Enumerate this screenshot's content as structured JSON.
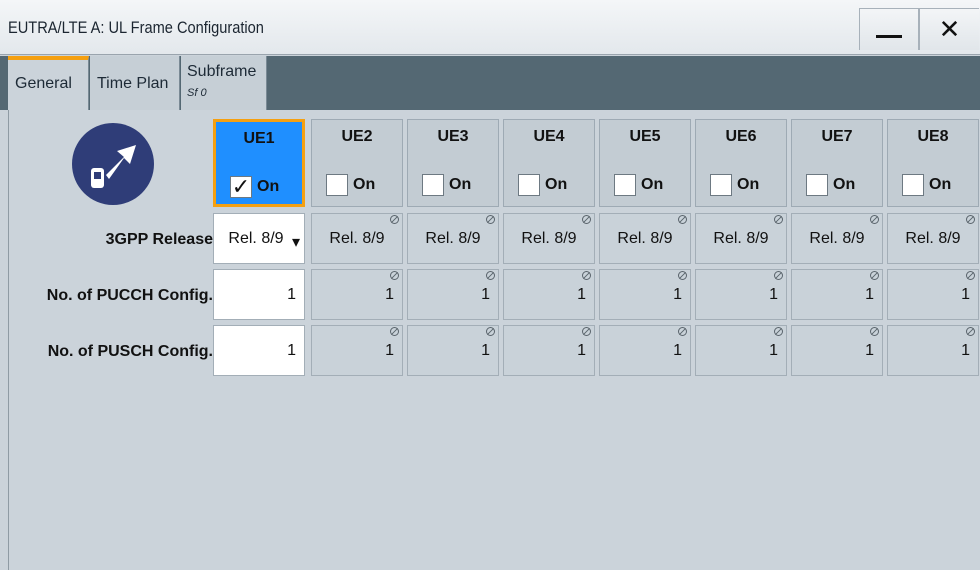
{
  "window": {
    "title": "EUTRA/LTE A: UL Frame Configuration",
    "minimize_glyph": "minimize",
    "close_glyph": "✕"
  },
  "tabs": [
    {
      "label": "General",
      "sub": "",
      "active": true
    },
    {
      "label": "Time Plan",
      "sub": "",
      "active": false
    },
    {
      "label": "Subframe",
      "sub": "Sf 0",
      "active": false
    }
  ],
  "ues": [
    {
      "name": "UE1",
      "on_label": "On",
      "checked": true,
      "active": true
    },
    {
      "name": "UE2",
      "on_label": "On",
      "checked": false
    },
    {
      "name": "UE3",
      "on_label": "On",
      "checked": false
    },
    {
      "name": "UE4",
      "on_label": "On",
      "checked": false
    },
    {
      "name": "UE5",
      "on_label": "On",
      "checked": false
    },
    {
      "name": "UE6",
      "on_label": "On",
      "checked": false
    },
    {
      "name": "UE7",
      "on_label": "On",
      "checked": false
    },
    {
      "name": "UE8",
      "on_label": "On",
      "checked": false
    }
  ],
  "rows": [
    {
      "label": "3GPP Release",
      "values": [
        "Rel. 8/9",
        "Rel. 8/9",
        "Rel. 8/9",
        "Rel. 8/9",
        "Rel. 8/9",
        "Rel. 8/9",
        "Rel. 8/9",
        "Rel. 8/9"
      ]
    },
    {
      "label": "No. of PUCCH Config.",
      "values": [
        "1",
        "1",
        "1",
        "1",
        "1",
        "1",
        "1",
        "1"
      ]
    },
    {
      "label": "No. of PUSCH Config.",
      "values": [
        "1",
        "1",
        "1",
        "1",
        "1",
        "1",
        "1",
        "1"
      ]
    }
  ],
  "colors": {
    "accent": "#f5a011",
    "active_ue": "#1f8fff",
    "icon_circle": "#2f3d78"
  },
  "icons": {
    "ue_graphic": "ue-uplink-icon",
    "dropdown": "▾",
    "locked": "locked-icon"
  }
}
